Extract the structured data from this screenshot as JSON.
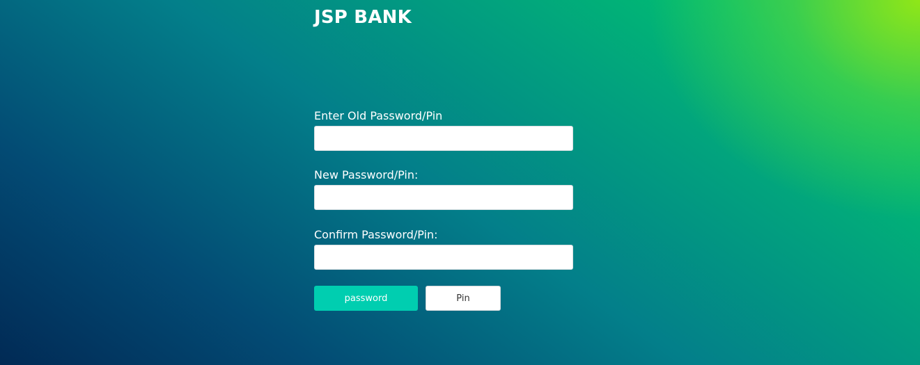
{
  "header": {
    "brand": "JSP BANK"
  },
  "form": {
    "old_label": "Enter Old Password/Pin",
    "old_value": "",
    "new_label": "New Password/Pin:",
    "new_value": "",
    "confirm_label": "Confirm Password/Pin:",
    "confirm_value": ""
  },
  "actions": {
    "password_label": "password",
    "pin_label": "Pin"
  },
  "colors": {
    "accent": "#00ceb0",
    "text_on_bg": "#ffffff"
  }
}
